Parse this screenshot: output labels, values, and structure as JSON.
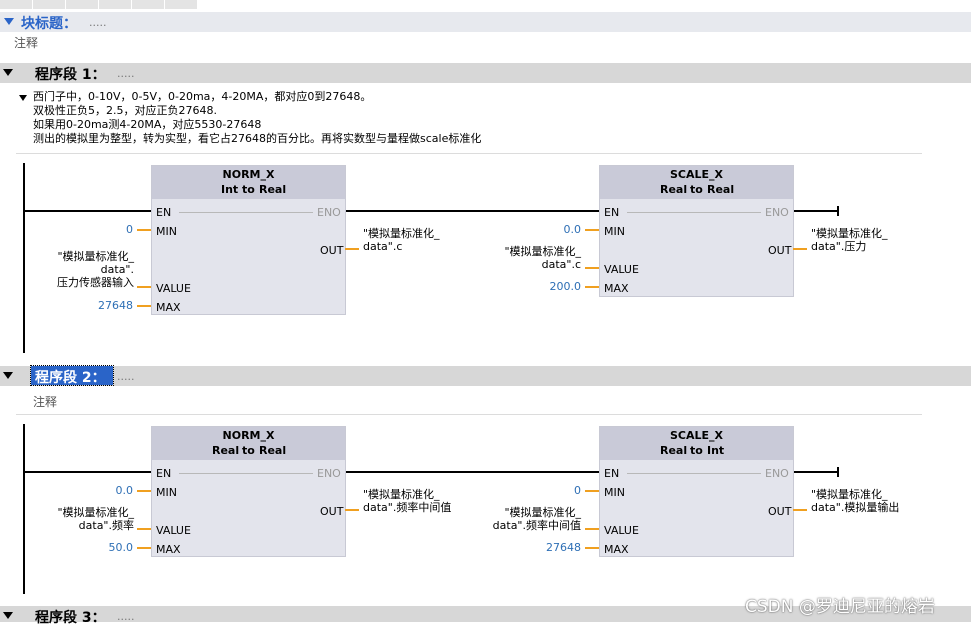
{
  "block_title": {
    "label": "块标题：",
    "dots": ".....",
    "comment": "注释"
  },
  "network1": {
    "title": "程序段 1：",
    "dots": ".....",
    "description": [
      "西门子中，0-10V，0-5V，0-20ma，4-20MA，都对应0到27648。",
      "双极性正负5，2.5，对应正负27648.",
      "如果用0-20ma测4-20MA，对应5530-27648",
      "测出的模拟里为整型，转为实型，看它占27648的百分比。再将实数型与量程做scale标准化"
    ],
    "norm": {
      "name": "NORM_X",
      "type_from": "Int",
      "to": "to",
      "type_to": "Real",
      "en": "EN",
      "eno": "ENO",
      "min": "MIN",
      "value": "VALUE",
      "max": "MAX",
      "out": "OUT",
      "min_val": "0",
      "value_lines": [
        "\"模拟量标准化_",
        "data\".",
        "压力传感器输入"
      ],
      "max_val": "27648",
      "out_lines": [
        "\"模拟量标准化_",
        "data\".c"
      ]
    },
    "scale": {
      "name": "SCALE_X",
      "type_from": "Real",
      "to": "to",
      "type_to": "Real",
      "en": "EN",
      "eno": "ENO",
      "min": "MIN",
      "value": "VALUE",
      "max": "MAX",
      "out": "OUT",
      "min_val": "0.0",
      "value_lines": [
        "\"模拟量标准化_",
        "data\".c"
      ],
      "max_val": "200.0",
      "out_lines": [
        "\"模拟量标准化_",
        "data\".压力"
      ]
    }
  },
  "network2": {
    "title": "程序段 2：",
    "dots": ".....",
    "comment": "注释",
    "norm": {
      "name": "NORM_X",
      "type_from": "Real",
      "to": "to",
      "type_to": "Real",
      "en": "EN",
      "eno": "ENO",
      "min": "MIN",
      "value": "VALUE",
      "max": "MAX",
      "out": "OUT",
      "min_val": "0.0",
      "value_lines": [
        "\"模拟量标准化_",
        "data\".频率"
      ],
      "max_val": "50.0",
      "out_lines": [
        "\"模拟量标准化_",
        "data\".频率中间值"
      ]
    },
    "scale": {
      "name": "SCALE_X",
      "type_from": "Real",
      "to": "to",
      "type_to": "Int",
      "en": "EN",
      "eno": "ENO",
      "min": "MIN",
      "value": "VALUE",
      "max": "MAX",
      "out": "OUT",
      "min_val": "0",
      "value_lines": [
        "\"模拟量标准化_",
        "data\".频率中间值"
      ],
      "max_val": "27648",
      "out_lines": [
        "\"模拟量标准化_",
        "data\".模拟量输出"
      ]
    }
  },
  "network3": {
    "title": "程序段 3：",
    "dots": "....."
  },
  "watermark": "CSDN @罗迪尼亚的熔岩",
  "colors": {
    "section_bg": "#d7d7d7",
    "block_head": "#c9cad8",
    "block_body": "#e3e4ec",
    "pin_wire": "#f0a020",
    "const_value": "#2e6fb5",
    "selected": "#2a64c8"
  }
}
